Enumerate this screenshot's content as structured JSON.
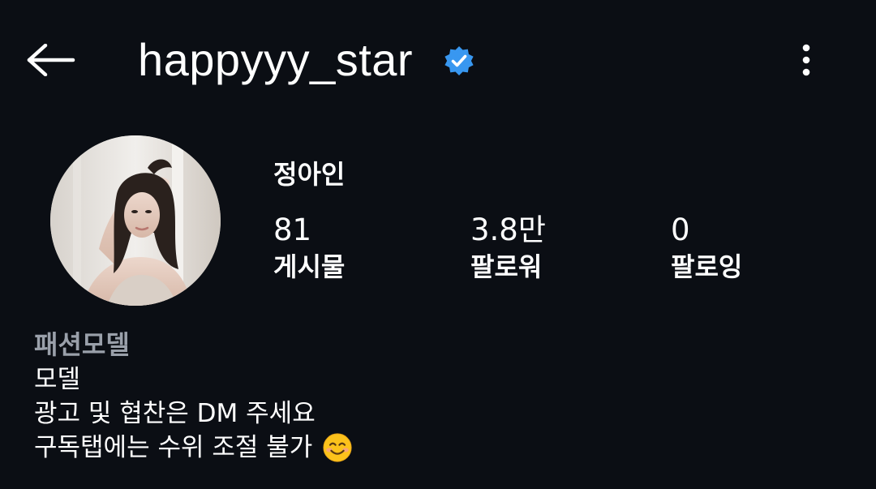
{
  "header": {
    "username": "happyyy_star",
    "verified": true,
    "back_icon": "arrow-left-icon",
    "more_icon": "more-vertical-icon",
    "verified_color": "#3897f0"
  },
  "profile": {
    "display_name": "정아인",
    "avatar": "profile-photo",
    "stats": [
      {
        "value": "81",
        "label": "게시물"
      },
      {
        "value": "3.8만",
        "label": "팔로워"
      },
      {
        "value": "0",
        "label": "팔로잉"
      }
    ]
  },
  "bio": {
    "category": "패션모델",
    "lines": [
      "모델",
      "광고 및 협찬은 DM 주세요",
      "구독탭에는 수위 조절 불가"
    ],
    "emoji": "smiling-face-icon"
  },
  "colors": {
    "background": "#0b0e14",
    "text": "#ffffff",
    "muted": "#9aa0aa"
  }
}
